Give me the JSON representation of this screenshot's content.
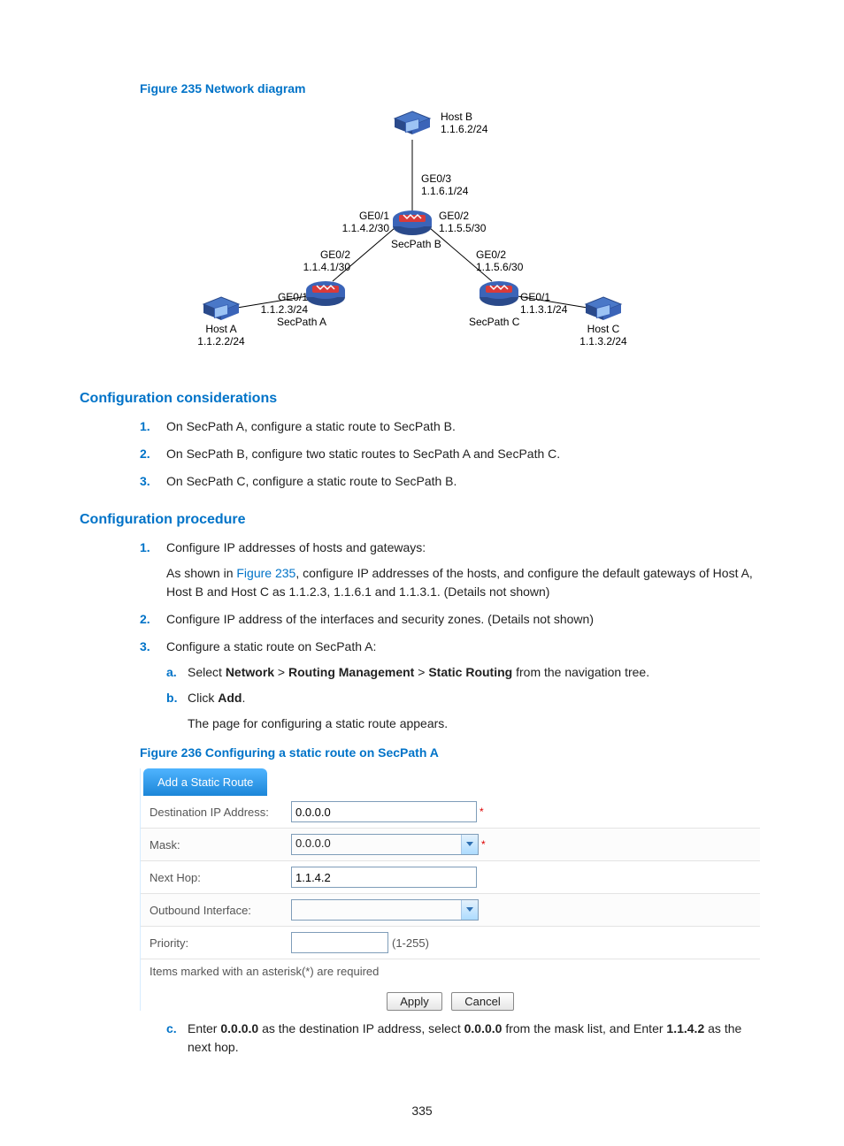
{
  "figure235": {
    "title": "Figure 235 Network diagram",
    "hostB": "Host B",
    "hostB_ip": "1.1.6.2/24",
    "ge03": "GE0/3",
    "ge03_ip": "1.1.6.1/24",
    "ge01_b": "GE0/1",
    "ge01_b_ip": "1.1.4.2/30",
    "ge02_b": "GE0/2",
    "ge02_b_ip": "1.1.5.5/30",
    "secpathB": "SecPath B",
    "ge02_a": "GE0/2",
    "ge02_a_ip": "1.1.4.1/30",
    "ge02_c": "GE0/2",
    "ge02_c_ip": "1.1.5.6/30",
    "secpathA": "SecPath A",
    "secpathC": "SecPath C",
    "ge01_a": "GE0/1",
    "ge01_a_ip": "1.1.2.3/24",
    "ge01_c": "GE0/1",
    "ge01_c_ip": "1.1.3.1/24",
    "hostA": "Host A",
    "hostA_ip": "1.1.2.2/24",
    "hostC": "Host C",
    "hostC_ip": "1.1.3.2/24"
  },
  "h_considerations": "Configuration considerations",
  "considerations": {
    "i1": "On SecPath A, configure a static route to SecPath B.",
    "i2": "On SecPath B, configure two static routes to SecPath A and SecPath C.",
    "i3": "On SecPath C, configure a static route to SecPath B."
  },
  "h_procedure": "Configuration procedure",
  "proc": {
    "i1": "Configure IP addresses of hosts and gateways:",
    "i1_sub_pre": "As shown in ",
    "i1_link": "Figure 235",
    "i1_sub_post": ", configure IP addresses of the hosts, and configure the default gateways of Host A, Host B and Host C as 1.1.2.3, 1.1.6.1 and 1.1.3.1. (Details not shown)",
    "i2": "Configure IP address of the interfaces and security zones. (Details not shown)",
    "i3": "Configure a static route on SecPath A:",
    "a_pre": "Select ",
    "a_b1": "Network",
    "a_gt": " > ",
    "a_b2": "Routing Management",
    "a_b3": "Static Routing",
    "a_post": " from the navigation tree.",
    "b_pre": "Click ",
    "b_b1": "Add",
    "b_post": ".",
    "b_sub": "The page for configuring a static route appears.",
    "c_pre": "Enter ",
    "c_b1": "0.0.0.0",
    "c_mid1": " as the destination IP address, select ",
    "c_b2": "0.0.0.0",
    "c_mid2": " from the mask list, and Enter ",
    "c_b3": "1.1.4.2",
    "c_post": " as the next hop."
  },
  "figure236": {
    "title": "Figure 236 Configuring a static route on SecPath A"
  },
  "form": {
    "tab": "Add a Static Route",
    "dest_label": "Destination IP Address:",
    "dest_val": "0.0.0.0",
    "mask_label": "Mask:",
    "mask_val": "0.0.0.0",
    "hop_label": "Next Hop:",
    "hop_val": "1.1.4.2",
    "ob_label": "Outbound Interface:",
    "ob_val": "",
    "pri_label": "Priority:",
    "pri_val": "",
    "pri_range": "(1-255)",
    "note": "Items marked with an asterisk(*) are required",
    "apply": "Apply",
    "cancel": "Cancel",
    "star": "*"
  },
  "pagenum": "335"
}
